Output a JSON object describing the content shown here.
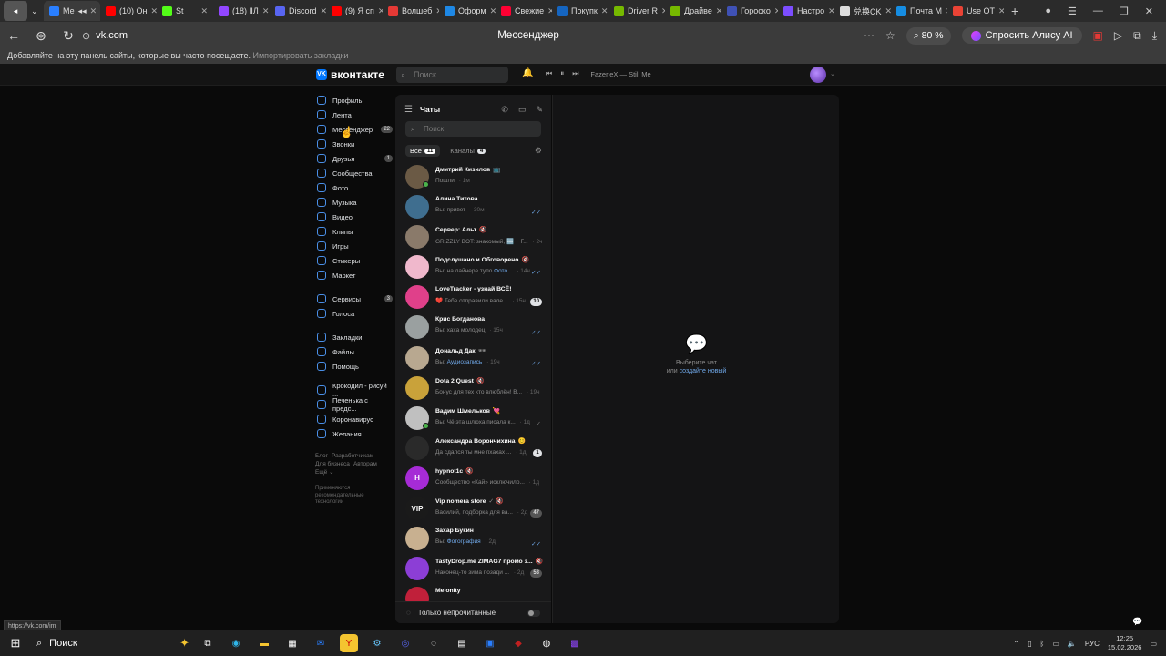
{
  "browser": {
    "tabs": [
      {
        "label": "Ме",
        "color": "#2a7fff",
        "active": true
      },
      {
        "label": "(10) Он",
        "color": "#ff0000"
      },
      {
        "label": "St",
        "color": "#53fc18"
      },
      {
        "label": "(18) ⅡЛ",
        "color": "#9146ff"
      },
      {
        "label": "Discord",
        "color": "#5865f2"
      },
      {
        "label": "(9) Я сп",
        "color": "#ff0000"
      },
      {
        "label": "Волшеб",
        "color": "#e53935"
      },
      {
        "label": "Оформ",
        "color": "#1e88e5"
      },
      {
        "label": "Свежие",
        "color": "#ff0033"
      },
      {
        "label": "Покупк",
        "color": "#1565c0"
      },
      {
        "label": "Driver R",
        "color": "#76b900"
      },
      {
        "label": "Драйве",
        "color": "#76b900"
      },
      {
        "label": "Гороско",
        "color": "#3f51b5"
      },
      {
        "label": "Настро",
        "color": "#7c4dff"
      },
      {
        "label": "兑换CK",
        "color": "#dddddd"
      },
      {
        "label": "Почта М",
        "color": "#168de2"
      },
      {
        "label": "Use OT",
        "color": "#ea4335"
      }
    ],
    "url": "vk.com",
    "page_title": "Мессенджер",
    "zoom": "80 %",
    "alice_label": "Спросить Алису AI",
    "bookmarks_hint": "Добавляйте на эту панель сайты, которые вы часто посещаете.",
    "bookmarks_import": "Импортировать закладки",
    "status_url": "https://vk.com/im"
  },
  "vk": {
    "logo": "вконтакте",
    "search_placeholder": "Поиск",
    "track": "FazerleX — Still Me",
    "nav": [
      {
        "label": "Профиль",
        "name": "profile"
      },
      {
        "label": "Лента",
        "name": "feed"
      },
      {
        "label": "Мессенджер",
        "name": "messenger",
        "badge": "22"
      },
      {
        "label": "Звонки",
        "name": "calls"
      },
      {
        "label": "Друзья",
        "name": "friends",
        "badge": "1"
      },
      {
        "label": "Сообщества",
        "name": "communities"
      },
      {
        "label": "Фото",
        "name": "photos"
      },
      {
        "label": "Музыка",
        "name": "music"
      },
      {
        "label": "Видео",
        "name": "video"
      },
      {
        "label": "Клипы",
        "name": "clips"
      },
      {
        "label": "Игры",
        "name": "games"
      },
      {
        "label": "Стикеры",
        "name": "stickers"
      },
      {
        "label": "Маркет",
        "name": "market"
      }
    ],
    "nav2": [
      {
        "label": "Сервисы",
        "name": "services",
        "badge": "3"
      },
      {
        "label": "Голоса",
        "name": "votes"
      }
    ],
    "nav3": [
      {
        "label": "Закладки",
        "name": "bookmarks"
      },
      {
        "label": "Файлы",
        "name": "files"
      },
      {
        "label": "Помощь",
        "name": "help"
      }
    ],
    "nav4": [
      {
        "label": "Крокодил - рисуй ...",
        "name": "app-crocodile"
      },
      {
        "label": "Печенька с предс...",
        "name": "app-cookie"
      },
      {
        "label": "Коронавирус",
        "name": "app-coronavirus"
      },
      {
        "label": "Желания",
        "name": "app-wishes"
      }
    ],
    "footer": {
      "blog": "Блог",
      "devs": "Разработчикам",
      "business": "Для бизнеса",
      "authors": "Авторам",
      "more": "Ещё ⌄",
      "rec": "Применяются рекомендательные технологии"
    },
    "chats": {
      "title": "Чаты",
      "search_placeholder": "Поиск",
      "tab_all": "Все",
      "tab_all_count": "11",
      "tab_channels": "Каналы",
      "tab_channels_count": "4",
      "unread_only": "Только непрочитанные",
      "empty_line1": "Выберите чат",
      "empty_or": "или",
      "empty_link": "создайте новый",
      "list": [
        {
          "name": "Дмитрий Кизилов",
          "extra": "📺",
          "prefix": "",
          "text": "Пошли",
          "time": "1м",
          "online": true,
          "ava": "#6b5a45"
        },
        {
          "name": "Алина Титова",
          "extra": "",
          "prefix": "Вы: ",
          "text": "привет",
          "time": "30м",
          "read": true,
          "ava": "#3f6e8f"
        },
        {
          "name": "Сервер: Альт",
          "extra": "🔇",
          "prefix": "",
          "text": "GRIZZLY BOT: знакомый, 🆒 + Г...",
          "time": "2ч",
          "ava": "#8a7a6a"
        },
        {
          "name": "Подслушано и Обговорено",
          "extra": "🔇",
          "prefix": "Вы: на лайнере тупо ",
          "hl": "Фото...",
          "text": "",
          "time": "14ч",
          "read": true,
          "ava": "#f0b8cc"
        },
        {
          "name": "LoveTracker - узнай ВСЁ!",
          "extra": "",
          "prefix": "",
          "text": "❤️ Тебе отправили вале...",
          "time": "15ч",
          "unread": "10",
          "ava": "#e0408a"
        },
        {
          "name": "Крис Богданова",
          "extra": "",
          "prefix": "Вы: ",
          "text": "хаха молодец",
          "time": "15ч",
          "read": true,
          "ava": "#9aa0a0"
        },
        {
          "name": "Дональд Дак",
          "extra": "🕶",
          "prefix": "Вы: ",
          "hl": "Аудиозапись",
          "text": "",
          "time": "19ч",
          "read": true,
          "ava": "#b8a890"
        },
        {
          "name": "Dota 2 Quest",
          "extra": "🔇",
          "prefix": "",
          "text": "Бонус для тех кто влюблён! В...",
          "time": "19ч",
          "ava": "#c9a23a"
        },
        {
          "name": "Вадим Шмельков",
          "extra": "💘",
          "prefix": "",
          "text": "Вы: Чё эта шлюха писала к...",
          "time": "1д",
          "readgrey": true,
          "online": true,
          "ava": "#c0c0c0"
        },
        {
          "name": "Александра Ворончихина",
          "extra": "😊",
          "prefix": "",
          "text": "Да сдался ты мне пхахах ...",
          "time": "1д",
          "unread": "1",
          "ava": "#2a2a2a"
        },
        {
          "name": "hypnot1c",
          "extra": "🔇",
          "prefix": "",
          "text": "Сообщество «Кай» исключило...",
          "time": "1д",
          "ava": "#a62bd6",
          "initial": "H"
        },
        {
          "name": "Vip nomera store",
          "extra": "✓ 🔇",
          "prefix": "",
          "text": "Василий, подборка для ва...",
          "time": "2д",
          "unread": "47",
          "muted": true,
          "ava": "#1a1a1a",
          "initial": "VIP"
        },
        {
          "name": "Захар Букин",
          "extra": "",
          "prefix": "Вы: ",
          "hl": "Фотография",
          "text": "",
          "time": "2д",
          "read": true,
          "ava": "#c8b090"
        },
        {
          "name": "TastyDrop.me ZIMAG7 промо з...",
          "extra": "🔇",
          "prefix": "",
          "text": "Наконец-то зима позади ...",
          "time": "2д",
          "unread": "53",
          "muted": true,
          "ava": "#8c3ed6"
        },
        {
          "name": "Melonity",
          "extra": "",
          "prefix": "",
          "text": "",
          "time": "",
          "ava": "#c0203a"
        }
      ]
    }
  },
  "taskbar": {
    "search": "Поиск",
    "lang": "РУС",
    "time": "12:25",
    "date": "15.02.2026"
  }
}
